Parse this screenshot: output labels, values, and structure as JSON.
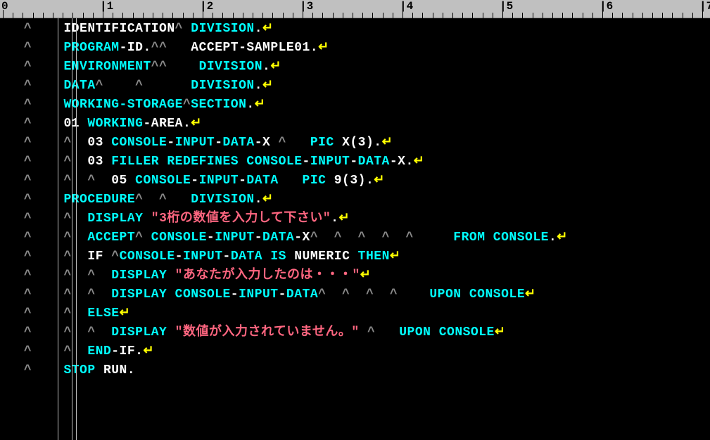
{
  "ruler": {
    "numbers": [
      0,
      1,
      2,
      3,
      4,
      5,
      6,
      7
    ],
    "charWidth": 14.2,
    "majorEvery": 10
  },
  "vlines": [
    82,
    102,
    108
  ],
  "lines": [
    {
      "indent": 8,
      "segs": [
        [
          "white",
          "IDENTIFICATION"
        ],
        [
          "caret",
          "^ "
        ],
        [
          "cyan",
          "DIVISION"
        ],
        [
          "white",
          "."
        ],
        [
          "nl",
          "↵"
        ]
      ]
    },
    {
      "indent": 8,
      "segs": [
        [
          "cyan",
          "PROGRAM"
        ],
        [
          "white",
          "-ID."
        ],
        [
          "caret",
          "^^   "
        ],
        [
          "white",
          "ACCEPT-SAMPLE01."
        ],
        [
          "nl",
          "↵"
        ]
      ]
    },
    {
      "indent": 8,
      "segs": [
        [
          "cyan",
          "ENVIRONMENT"
        ],
        [
          "caret",
          "^^    "
        ],
        [
          "cyan",
          "DIVISION"
        ],
        [
          "white",
          "."
        ],
        [
          "nl",
          "↵"
        ]
      ]
    },
    {
      "indent": 8,
      "segs": [
        [
          "cyan",
          "DATA"
        ],
        [
          "caret",
          "^    ^      "
        ],
        [
          "cyan",
          "DIVISION"
        ],
        [
          "white",
          "."
        ],
        [
          "nl",
          "↵"
        ]
      ]
    },
    {
      "indent": 8,
      "segs": [
        [
          "cyan",
          "WORKING-STORAGE"
        ],
        [
          "caret",
          "^"
        ],
        [
          "cyan",
          "SECTION"
        ],
        [
          "white",
          "."
        ],
        [
          "nl",
          "↵"
        ]
      ]
    },
    {
      "indent": 8,
      "segs": [
        [
          "white",
          "01 "
        ],
        [
          "cyan",
          "WORKING"
        ],
        [
          "white",
          "-AREA."
        ],
        [
          "nl",
          "↵"
        ]
      ]
    },
    {
      "indent": 8,
      "segs": [
        [
          "caret",
          "^  "
        ],
        [
          "white",
          "03 "
        ],
        [
          "cyan",
          "CONSOLE"
        ],
        [
          "white",
          "-"
        ],
        [
          "cyan",
          "INPUT"
        ],
        [
          "white",
          "-"
        ],
        [
          "cyan",
          "DATA"
        ],
        [
          "white",
          "-X "
        ],
        [
          "caret",
          "^   "
        ],
        [
          "cyan",
          "PIC"
        ],
        [
          "white",
          " X(3)."
        ],
        [
          "nl",
          "↵"
        ]
      ]
    },
    {
      "indent": 8,
      "segs": [
        [
          "caret",
          "^  "
        ],
        [
          "white",
          "03 "
        ],
        [
          "cyan",
          "FILLER REDEFINES CONSOLE"
        ],
        [
          "white",
          "-"
        ],
        [
          "cyan",
          "INPUT"
        ],
        [
          "white",
          "-"
        ],
        [
          "cyan",
          "DATA"
        ],
        [
          "white",
          "-X."
        ],
        [
          "nl",
          "↵"
        ]
      ]
    },
    {
      "indent": 8,
      "segs": [
        [
          "caret",
          "^  ^  "
        ],
        [
          "white",
          "05 "
        ],
        [
          "cyan",
          "CONSOLE"
        ],
        [
          "white",
          "-"
        ],
        [
          "cyan",
          "INPUT"
        ],
        [
          "white",
          "-"
        ],
        [
          "cyan",
          "DATA   PIC"
        ],
        [
          "white",
          " 9(3)."
        ],
        [
          "nl",
          "↵"
        ]
      ]
    },
    {
      "indent": 8,
      "segs": [
        [
          "cyan",
          "PROCEDURE"
        ],
        [
          "caret",
          "^  ^   "
        ],
        [
          "cyan",
          "DIVISION"
        ],
        [
          "white",
          "."
        ],
        [
          "nl",
          "↵"
        ]
      ]
    },
    {
      "indent": 8,
      "segs": [
        [
          "caret",
          "^  "
        ],
        [
          "cyan",
          "DISPLAY "
        ],
        [
          "red",
          "\"3桁の数値を入力して下さい\""
        ],
        [
          "white",
          "."
        ],
        [
          "nl",
          "↵"
        ]
      ]
    },
    {
      "indent": 8,
      "segs": [
        [
          "caret",
          "^  "
        ],
        [
          "cyan",
          "ACCEPT"
        ],
        [
          "caret",
          "^ "
        ],
        [
          "cyan",
          "CONSOLE"
        ],
        [
          "white",
          "-"
        ],
        [
          "cyan",
          "INPUT"
        ],
        [
          "white",
          "-"
        ],
        [
          "cyan",
          "DATA"
        ],
        [
          "white",
          "-X"
        ],
        [
          "caret",
          "^  ^  ^  ^  ^     "
        ],
        [
          "cyan",
          "FROM CONSOLE"
        ],
        [
          "white",
          "."
        ],
        [
          "nl",
          "↵"
        ]
      ]
    },
    {
      "indent": 8,
      "segs": [
        [
          "caret",
          "^  "
        ],
        [
          "white",
          "IF "
        ],
        [
          "caret",
          "^"
        ],
        [
          "cyan",
          "CONSOLE"
        ],
        [
          "white",
          "-"
        ],
        [
          "cyan",
          "INPUT"
        ],
        [
          "white",
          "-"
        ],
        [
          "cyan",
          "DATA IS"
        ],
        [
          "white",
          " NUMERIC "
        ],
        [
          "cyan",
          "THEN"
        ],
        [
          "nl",
          "↵"
        ]
      ]
    },
    {
      "indent": 8,
      "segs": [
        [
          "caret",
          "^  ^  "
        ],
        [
          "cyan",
          "DISPLAY "
        ],
        [
          "red",
          "\"あなたが入力したのは・・・\""
        ],
        [
          "nl",
          "↵"
        ]
      ]
    },
    {
      "indent": 8,
      "segs": [
        [
          "caret",
          "^  ^  "
        ],
        [
          "cyan",
          "DISPLAY CONSOLE"
        ],
        [
          "white",
          "-"
        ],
        [
          "cyan",
          "INPUT"
        ],
        [
          "white",
          "-"
        ],
        [
          "cyan",
          "DATA"
        ],
        [
          "caret",
          "^  ^  ^  ^    "
        ],
        [
          "cyan",
          "UPON CONSOLE"
        ],
        [
          "nl",
          "↵"
        ]
      ]
    },
    {
      "indent": 8,
      "segs": [
        [
          "caret",
          "^  "
        ],
        [
          "cyan",
          "ELSE"
        ],
        [
          "nl",
          "↵"
        ]
      ]
    },
    {
      "indent": 8,
      "segs": [
        [
          "caret",
          "^  ^  "
        ],
        [
          "cyan",
          "DISPLAY "
        ],
        [
          "red",
          "\"数値が入力されていません。\""
        ],
        [
          "caret",
          " ^   "
        ],
        [
          "cyan",
          "UPON CONSOLE"
        ],
        [
          "nl",
          "↵"
        ]
      ]
    },
    {
      "indent": 8,
      "segs": [
        [
          "caret",
          "^  "
        ],
        [
          "cyan",
          "END"
        ],
        [
          "white",
          "-IF."
        ],
        [
          "nl",
          "↵"
        ]
      ]
    },
    {
      "indent": 8,
      "segs": [
        [
          "cyan",
          "STOP"
        ],
        [
          "white",
          " RUN."
        ]
      ]
    }
  ]
}
